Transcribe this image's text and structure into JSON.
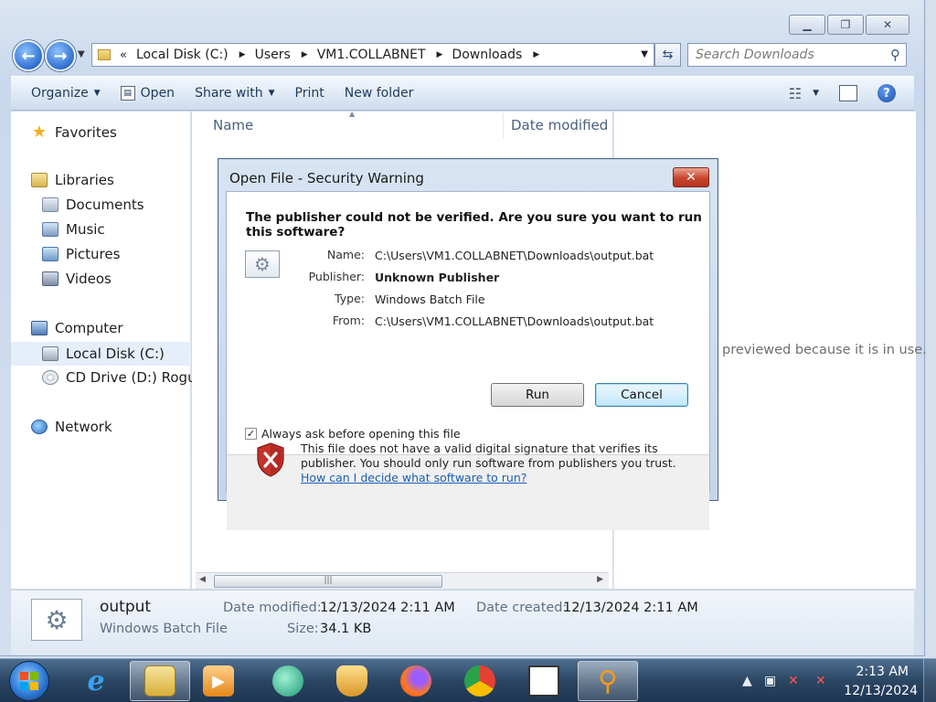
{
  "explorer": {
    "address": {
      "segments": [
        "Local Disk (C:)",
        "Users",
        "VM1.COLLABNET",
        "Downloads"
      ],
      "overflow": "«"
    },
    "search_placeholder": "Search Downloads",
    "toolbar": {
      "organize": "Organize",
      "open": "Open",
      "share_with": "Share with",
      "print": "Print",
      "new_folder": "New folder"
    },
    "nav": {
      "favorites": "Favorites",
      "libraries": "Libraries",
      "documents": "Documents",
      "music": "Music",
      "pictures": "Pictures",
      "videos": "Videos",
      "computer": "Computer",
      "local_disk": "Local Disk (C:)",
      "cd_drive": "CD Drive (D:) Rogue",
      "network": "Network"
    },
    "columns": {
      "name": "Name",
      "date_modified": "Date modified"
    },
    "preview_message": "previewed because it is in use.",
    "details": {
      "name": "output",
      "type": "Windows Batch File",
      "date_modified_label": "Date modified:",
      "date_modified": "12/13/2024 2:11 AM",
      "date_created_label": "Date created:",
      "date_created": "12/13/2024 2:11 AM",
      "size_label": "Size:",
      "size": "34.1 KB"
    }
  },
  "dialog": {
    "title": "Open File - Security Warning",
    "heading": "The publisher could not be verified.  Are you sure you want to run this software?",
    "fields": {
      "name_label": "Name:",
      "name": "C:\\Users\\VM1.COLLABNET\\Downloads\\output.bat",
      "publisher_label": "Publisher:",
      "publisher": "Unknown Publisher",
      "type_label": "Type:",
      "type": "Windows Batch File",
      "from_label": "From:",
      "from": "C:\\Users\\VM1.COLLABNET\\Downloads\\output.bat"
    },
    "run_label": "Run",
    "cancel_label": "Cancel",
    "checkbox_label": "Always ask before opening this file",
    "checkbox_checked": true,
    "footer_text": "This file does not have a valid digital signature that verifies its publisher.  You should only run software from publishers you trust.",
    "footer_link": "How can I decide what software to run?"
  },
  "taskbar": {
    "apps": [
      "start",
      "internet-explorer",
      "windows-explorer",
      "media-player",
      "chat",
      "security",
      "firefox",
      "chrome",
      "remote-desktop",
      "search-tool"
    ],
    "time": "2:13 AM",
    "date": "12/13/2024"
  }
}
